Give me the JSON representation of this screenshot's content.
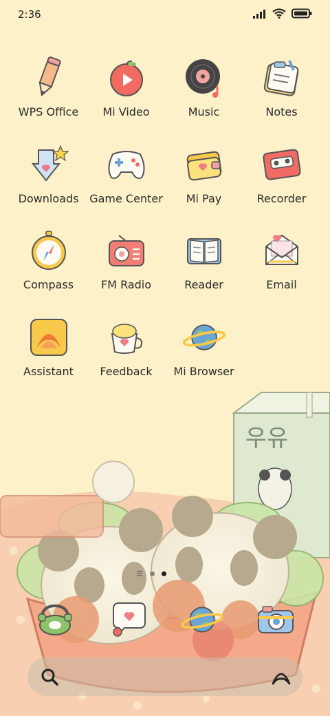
{
  "status_bar": {
    "time": "2:36"
  },
  "apps": [
    {
      "label": "WPS Office",
      "icon": "pencil-icon"
    },
    {
      "label": "Mi Video",
      "icon": "apple-play-icon"
    },
    {
      "label": "Music",
      "icon": "vinyl-record-icon"
    },
    {
      "label": "Notes",
      "icon": "notepad-icon"
    },
    {
      "label": "Downloads",
      "icon": "download-arrow-icon"
    },
    {
      "label": "Game Center",
      "icon": "gamepad-icon"
    },
    {
      "label": "Mi Pay",
      "icon": "wallet-icon"
    },
    {
      "label": "Recorder",
      "icon": "cassette-icon"
    },
    {
      "label": "Compass",
      "icon": "compass-icon"
    },
    {
      "label": "FM Radio",
      "icon": "radio-icon"
    },
    {
      "label": "Reader",
      "icon": "book-icon"
    },
    {
      "label": "Email",
      "icon": "envelope-icon"
    },
    {
      "label": "Assistant",
      "icon": "assistant-icon"
    },
    {
      "label": "Feedback",
      "icon": "cup-icon"
    },
    {
      "label": "Mi Browser",
      "icon": "planet-icon"
    }
  ],
  "dock": [
    {
      "icon": "phone-icon"
    },
    {
      "icon": "message-bubble-icon"
    },
    {
      "icon": "planet-icon"
    },
    {
      "icon": "camera-icon"
    }
  ],
  "wallpaper": {
    "box_text": "우유"
  },
  "colors": {
    "background": "#fdf1c9",
    "accent": "#f08a6e"
  }
}
